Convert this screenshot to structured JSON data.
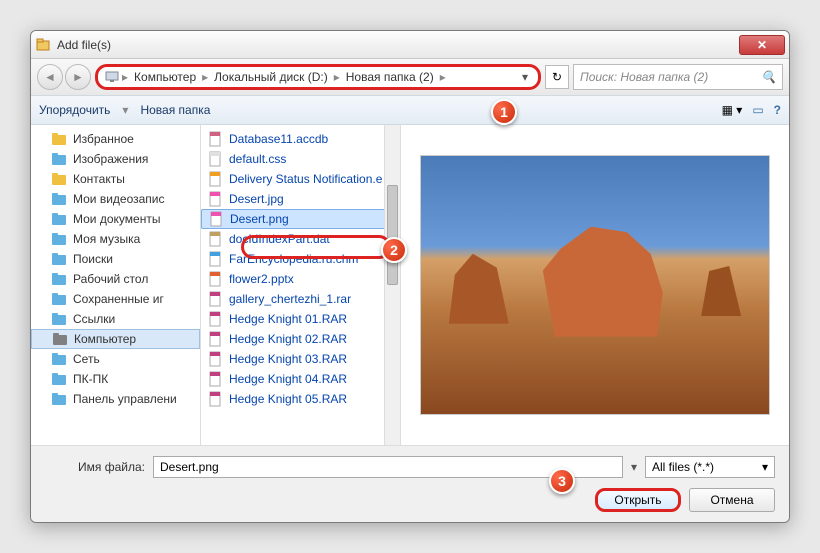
{
  "window": {
    "title": "Add file(s)"
  },
  "breadcrumb": {
    "items": [
      "Компьютер",
      "Локальный диск (D:)",
      "Новая папка (2)"
    ]
  },
  "search": {
    "placeholder": "Поиск: Новая папка (2)"
  },
  "toolbar": {
    "organize": "Упорядочить",
    "newfolder": "Новая папка"
  },
  "sidebar": {
    "items": [
      {
        "label": "Избранное",
        "color": "#f0c040"
      },
      {
        "label": "Изображения",
        "color": "#60b0e0"
      },
      {
        "label": "Контакты",
        "color": "#f0c040"
      },
      {
        "label": "Мои видеозапис",
        "color": "#60b0e0"
      },
      {
        "label": "Мои документы",
        "color": "#60b0e0"
      },
      {
        "label": "Моя музыка",
        "color": "#60b0e0"
      },
      {
        "label": "Поиски",
        "color": "#60b0e0"
      },
      {
        "label": "Рабочий стол",
        "color": "#60b0e0"
      },
      {
        "label": "Сохраненные иг",
        "color": "#60b0e0"
      },
      {
        "label": "Ссылки",
        "color": "#60b0e0"
      },
      {
        "label": "Компьютер",
        "color": "#808080",
        "sel": true
      },
      {
        "label": "Сеть",
        "color": "#60b0e0"
      },
      {
        "label": "ПК-ПК",
        "color": "#60b0e0"
      },
      {
        "label": "Панель управлени",
        "color": "#60b0e0"
      }
    ]
  },
  "files": {
    "items": [
      {
        "label": "Database11.accdb",
        "icon": "#d06080"
      },
      {
        "label": "default.css",
        "icon": "#e0e0e0"
      },
      {
        "label": "Delivery Status Notification.e",
        "icon": "#f0a020"
      },
      {
        "label": "Desert.jpg",
        "icon": "#f050b0"
      },
      {
        "label": "Desert.png",
        "icon": "#f050b0",
        "sel": true
      },
      {
        "label": "docIdIndexPart.dat",
        "icon": "#c0a060"
      },
      {
        "label": "FarEncyclopedia.ru.chm",
        "icon": "#40a0e0"
      },
      {
        "label": "flower2.pptx",
        "icon": "#e06030"
      },
      {
        "label": "gallery_chertezhi_1.rar",
        "icon": "#c04080"
      },
      {
        "label": "Hedge Knight 01.RAR",
        "icon": "#c04080"
      },
      {
        "label": "Hedge Knight 02.RAR",
        "icon": "#c04080"
      },
      {
        "label": "Hedge Knight 03.RAR",
        "icon": "#c04080"
      },
      {
        "label": "Hedge Knight 04.RAR",
        "icon": "#c04080"
      },
      {
        "label": "Hedge Knight 05.RAR",
        "icon": "#c04080"
      }
    ]
  },
  "bottom": {
    "filelabel": "Имя файла:",
    "filename": "Desert.png",
    "filter": "All files (*.*)",
    "open": "Открыть",
    "cancel": "Отмена"
  },
  "markers": {
    "m1": "1",
    "m2": "2",
    "m3": "3"
  }
}
